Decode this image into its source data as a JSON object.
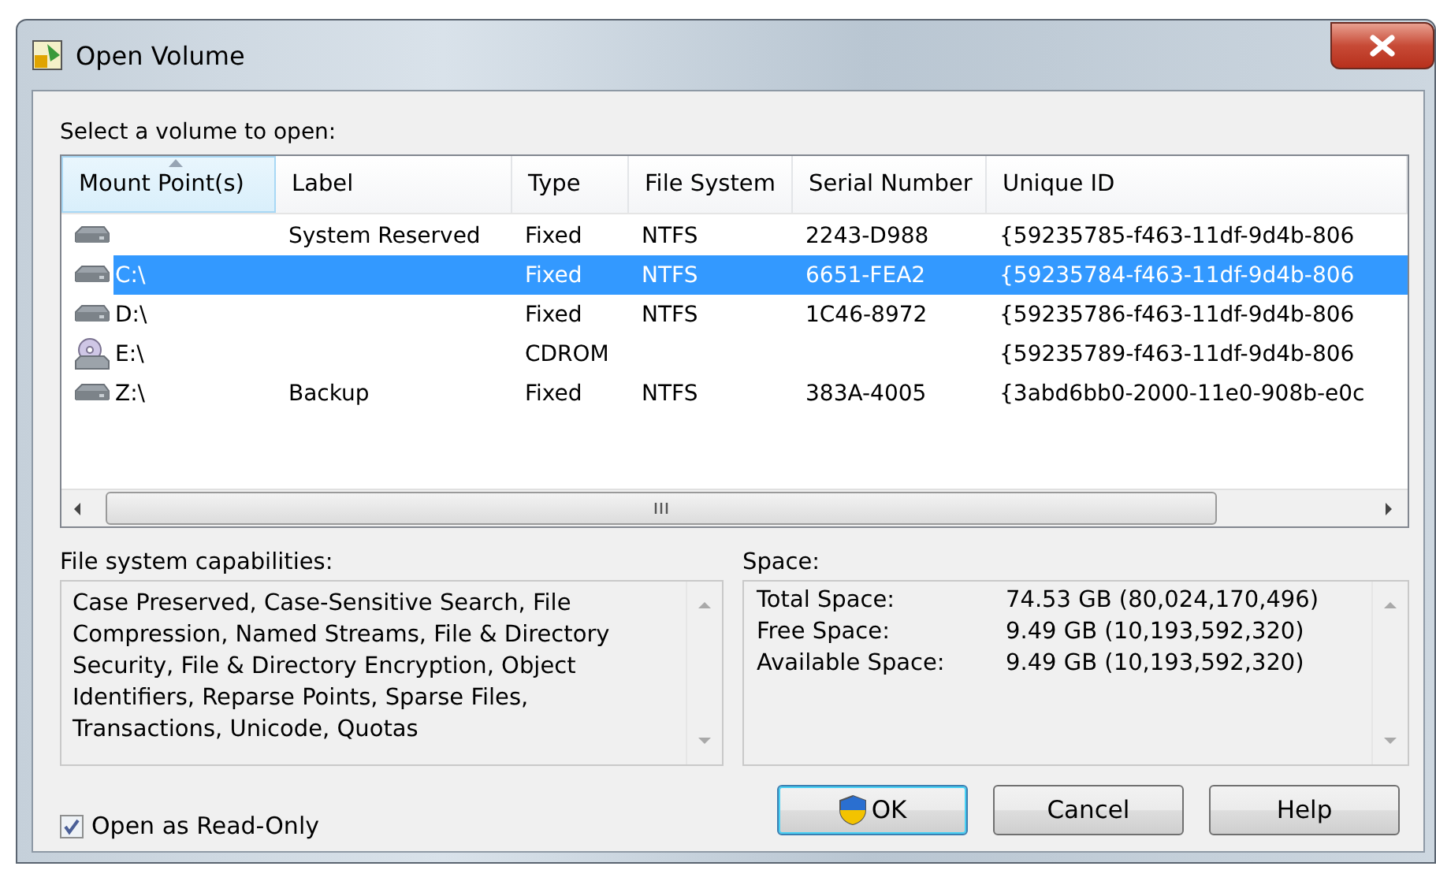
{
  "window": {
    "title": "Open Volume"
  },
  "prompt": "Select a volume to open:",
  "volumes": {
    "columns": [
      {
        "label": "Mount Point(s)",
        "sorted": true
      },
      {
        "label": "Label",
        "sorted": false
      },
      {
        "label": "Type",
        "sorted": false
      },
      {
        "label": "File System",
        "sorted": false
      },
      {
        "label": "Serial Number",
        "sorted": false
      },
      {
        "label": "Unique ID",
        "sorted": false
      }
    ],
    "rows": [
      {
        "kind": "disk",
        "mount": "",
        "label": "System Reserved",
        "type": "Fixed",
        "fs": "NTFS",
        "serial": "2243-D988",
        "uid": "{59235785-f463-11df-9d4b-806",
        "selected": false
      },
      {
        "kind": "disk",
        "mount": "C:\\",
        "label": "",
        "type": "Fixed",
        "fs": "NTFS",
        "serial": "6651-FEA2",
        "uid": "{59235784-f463-11df-9d4b-806",
        "selected": true
      },
      {
        "kind": "disk",
        "mount": "D:\\",
        "label": "",
        "type": "Fixed",
        "fs": "NTFS",
        "serial": "1C46-8972",
        "uid": "{59235786-f463-11df-9d4b-806",
        "selected": false
      },
      {
        "kind": "cdrom",
        "mount": "E:\\",
        "label": "",
        "type": "CDROM",
        "fs": "",
        "serial": "",
        "uid": "{59235789-f463-11df-9d4b-806",
        "selected": false
      },
      {
        "kind": "disk",
        "mount": "Z:\\",
        "label": "Backup",
        "type": "Fixed",
        "fs": "NTFS",
        "serial": "383A-4005",
        "uid": "{3abd6bb0-2000-11e0-908b-e0c",
        "selected": false
      }
    ]
  },
  "capabilities": {
    "heading": "File system capabilities:",
    "text": "Case Preserved, Case-Sensitive Search, File Compression, Named Streams, File & Directory Security, File & Directory Encryption, Object Identifiers, Reparse Points, Sparse Files, Transactions, Unicode, Quotas"
  },
  "space": {
    "heading": "Space:",
    "rows": [
      {
        "label": "Total Space:",
        "value": "74.53 GB (80,024,170,496)"
      },
      {
        "label": "Free Space:",
        "value": "9.49 GB (10,193,592,320)"
      },
      {
        "label": "Available Space:",
        "value": "9.49 GB (10,193,592,320)"
      }
    ]
  },
  "read_only": {
    "label": "Open as Read-Only",
    "checked": true
  },
  "buttons": [
    {
      "label": "OK",
      "default": true,
      "shield": true
    },
    {
      "label": "Cancel",
      "default": false,
      "shield": false
    },
    {
      "label": "Help",
      "default": false,
      "shield": false
    }
  ]
}
